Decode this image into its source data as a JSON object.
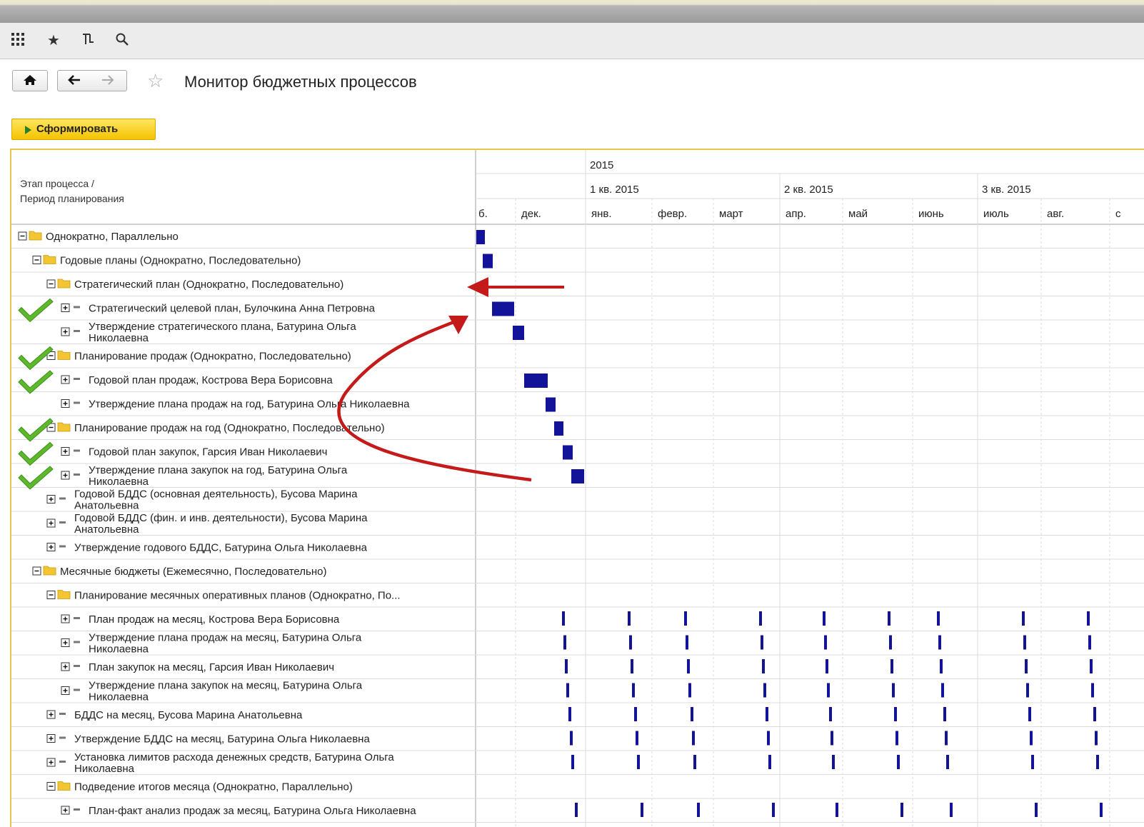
{
  "toolbar": {
    "icons": [
      "apps-grid-icon",
      "favorites-star-icon",
      "history-icon",
      "search-icon"
    ]
  },
  "nav": {
    "title": "Монитор бюджетных процессов"
  },
  "actions": {
    "form_label": "Сформировать"
  },
  "grid": {
    "header_left_line1": "Этап процесса /",
    "header_left_line2": "Период планирования",
    "year": "2015",
    "quarters": [
      "1 кв. 2015",
      "2 кв. 2015",
      "3 кв. 2015"
    ],
    "months": [
      "б.",
      "дек.",
      "янв.",
      "февр.",
      "март",
      "апр.",
      "май",
      "июнь",
      "июль",
      "авг.",
      "с"
    ]
  },
  "rows": [
    {
      "level": 0,
      "type": "group",
      "text": "Однократно, Параллельно",
      "check": false
    },
    {
      "level": 1,
      "type": "group",
      "text": "Годовые планы (Однократно, Последовательно)",
      "check": false
    },
    {
      "level": 2,
      "type": "group",
      "text": "Стратегический план (Однократно, Последовательно)",
      "check": false
    },
    {
      "level": 3,
      "type": "task",
      "lines": [
        "Стратегический целевой план, Булочкина Анна Петровна"
      ],
      "check": true
    },
    {
      "level": 3,
      "type": "task",
      "lines": [
        "Утверждение стратегического плана, Батурина Ольга",
        "Николаевна"
      ],
      "check": false
    },
    {
      "level": 2,
      "type": "group",
      "text": "Планирование продаж (Однократно, Последовательно)",
      "check": true
    },
    {
      "level": 3,
      "type": "task",
      "lines": [
        "Годовой план продаж, Кострова Вера Борисовна"
      ],
      "check": true
    },
    {
      "level": 3,
      "type": "task",
      "lines": [
        "Утверждение плана продаж на год, Батурина Ольга Николаевна"
      ],
      "check": false
    },
    {
      "level": 2,
      "type": "group",
      "text": "Планирование продаж на год (Однократно, Последовательно)",
      "check": true
    },
    {
      "level": 3,
      "type": "task",
      "lines": [
        "Годовой план закупок, Гарсия Иван Николаевич"
      ],
      "check": true
    },
    {
      "level": 3,
      "type": "task",
      "lines": [
        "Утверждение плана закупок на год, Батурина Ольга",
        "Николаевна"
      ],
      "check": true
    },
    {
      "level": 2,
      "type": "task",
      "lines": [
        "Годовой БДДС (основная деятельность), Бусова Марина",
        "Анатольевна"
      ],
      "check": false
    },
    {
      "level": 2,
      "type": "task",
      "lines": [
        "Годовой БДДС (фин. и инв. деятельности), Бусова Марина",
        "Анатольевна"
      ],
      "check": false
    },
    {
      "level": 2,
      "type": "task",
      "lines": [
        "Утверждение годового БДДС, Батурина Ольга Николаевна"
      ],
      "check": false
    },
    {
      "level": 1,
      "type": "group",
      "text": "Месячные бюджеты (Ежемесячно, Последовательно)",
      "check": false
    },
    {
      "level": 2,
      "type": "group",
      "text": "Планирование месячных оперативных планов (Однократно, По...",
      "check": false
    },
    {
      "level": 3,
      "type": "task",
      "lines": [
        "План продаж на месяц, Кострова Вера Борисовна"
      ],
      "check": false
    },
    {
      "level": 3,
      "type": "task",
      "lines": [
        "Утверждение плана продаж на месяц, Батурина Ольга",
        "Николаевна"
      ],
      "check": false
    },
    {
      "level": 3,
      "type": "task",
      "lines": [
        "План закупок на месяц, Гарсия Иван Николаевич"
      ],
      "check": false
    },
    {
      "level": 3,
      "type": "task",
      "lines": [
        "Утверждение плана закупок на месяц, Батурина Ольга",
        "Николаевна"
      ],
      "check": false
    },
    {
      "level": 2,
      "type": "task",
      "lines": [
        "БДДС на месяц, Бусова Марина Анатольевна"
      ],
      "check": false
    },
    {
      "level": 2,
      "type": "task",
      "lines": [
        "Утверждение БДДС на месяц, Батурина Ольга Николаевна"
      ],
      "check": false
    },
    {
      "level": 2,
      "type": "task",
      "lines": [
        "Установка лимитов расхода денежных средств, Батурина Ольга",
        "Николаевна"
      ],
      "check": false
    },
    {
      "level": 2,
      "type": "group",
      "text": "Подведение итогов месяца (Однократно, Параллельно)",
      "check": false
    },
    {
      "level": 3,
      "type": "task",
      "lines": [
        "План-факт анализ продаж за месяц, Батурина Ольга Николаевна"
      ],
      "check": false
    }
  ],
  "colors": {
    "bar": "#13139a",
    "arrow": "#c41a1a",
    "check": "#5db82c",
    "folder": "#f3c530",
    "grid": "#dcdcdc",
    "highlight_border": "#e9c64a"
  }
}
